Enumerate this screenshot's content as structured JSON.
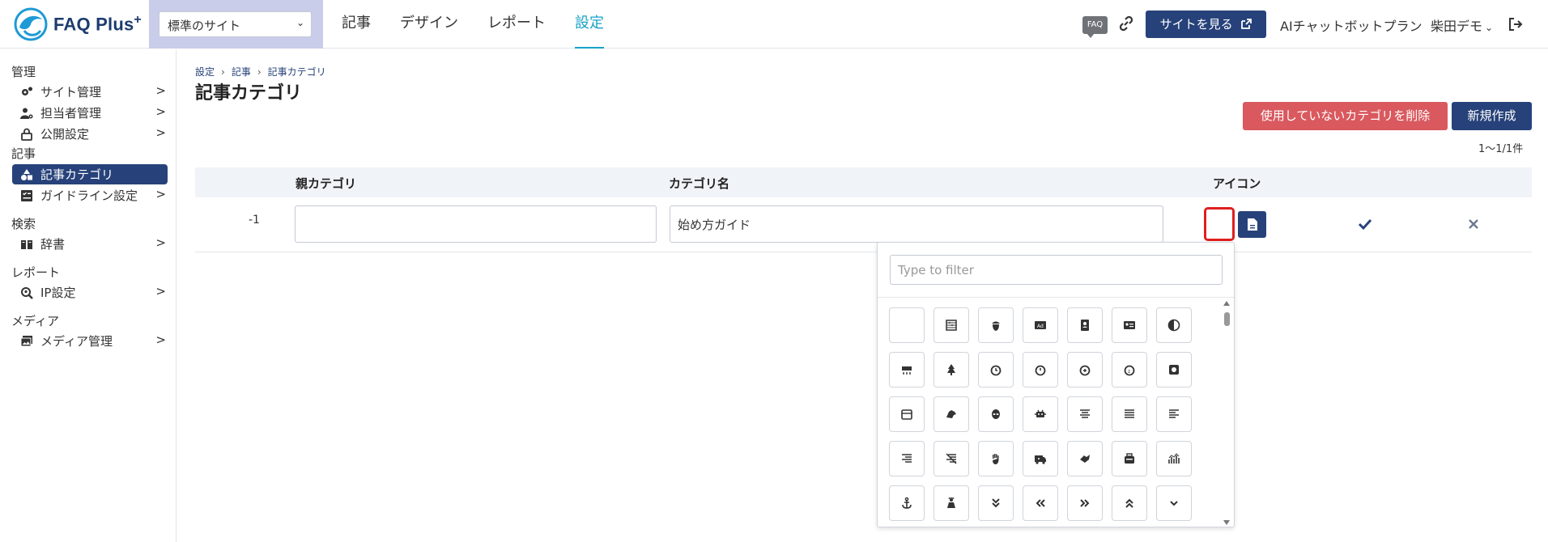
{
  "header": {
    "logo_text": "FAQ Plus",
    "logo_plus": "+",
    "site_select_value": "標準のサイト",
    "nav": [
      {
        "label": "記事",
        "active": false
      },
      {
        "label": "デザイン",
        "active": false
      },
      {
        "label": "レポート",
        "active": false
      },
      {
        "label": "設定",
        "active": true
      }
    ],
    "faq_badge": "FAQ",
    "view_site_label": "サイトを見る",
    "plan_label": "AIチャットボットプラン",
    "user_label": "柴田デモ"
  },
  "sidebar": {
    "sections": [
      {
        "label": "管理",
        "items": [
          {
            "label": "サイト管理",
            "icon": "gears-icon"
          },
          {
            "label": "担当者管理",
            "icon": "user-gear-icon"
          },
          {
            "label": "公開設定",
            "icon": "lock-icon"
          }
        ]
      },
      {
        "label": "記事",
        "items": [
          {
            "label": "記事カテゴリ",
            "icon": "shapes-icon",
            "active": true
          },
          {
            "label": "ガイドライン設定",
            "icon": "checklist-icon"
          }
        ]
      },
      {
        "label": "検索",
        "items": [
          {
            "label": "辞書",
            "icon": "book-icon"
          }
        ]
      },
      {
        "label": "レポート",
        "items": [
          {
            "label": "IP設定",
            "icon": "search-location-icon"
          }
        ]
      },
      {
        "label": "メディア",
        "items": [
          {
            "label": "メディア管理",
            "icon": "images-icon"
          }
        ]
      }
    ],
    "chevron": ">"
  },
  "main": {
    "breadcrumb": [
      "設定",
      "記事",
      "記事カテゴリ"
    ],
    "breadcrumb_sep": "›",
    "title": "記事カテゴリ",
    "delete_unused_label": "使用していないカテゴリを削除",
    "new_label": "新規作成",
    "count": "1～1/1件",
    "table": {
      "headers": [
        "親カテゴリ",
        "カテゴリ名",
        "アイコン"
      ],
      "row": {
        "index": "-1",
        "parent": "",
        "name": "始め方ガイド"
      }
    }
  },
  "icon_picker": {
    "filter_placeholder": "Type to filter",
    "icons": [
      "empty-icon",
      "abacus-icon",
      "acorn-icon",
      "ad-icon",
      "address-book-icon",
      "address-card-icon",
      "adjust-icon",
      "air-conditioner-icon",
      "air-freshener-icon",
      "alarm-clock-icon",
      "alarm-exclamation-icon",
      "alarm-plus-icon",
      "alarm-snooze-icon",
      "album-icon",
      "album-collection-icon",
      "alicorn-icon",
      "alien-icon",
      "alien-monster-icon",
      "align-center-icon",
      "align-justify-icon",
      "align-left-icon",
      "align-right-icon",
      "align-slash-icon",
      "allergies-icon",
      "ambulance-icon",
      "american-sign-language-icon",
      "amp-guitar-icon",
      "analytics-icon",
      "anchor-icon",
      "angel-icon",
      "angle-double-down-icon",
      "angle-double-left-icon",
      "angle-double-right-icon",
      "angle-double-up-icon",
      "angle-down-icon"
    ]
  }
}
